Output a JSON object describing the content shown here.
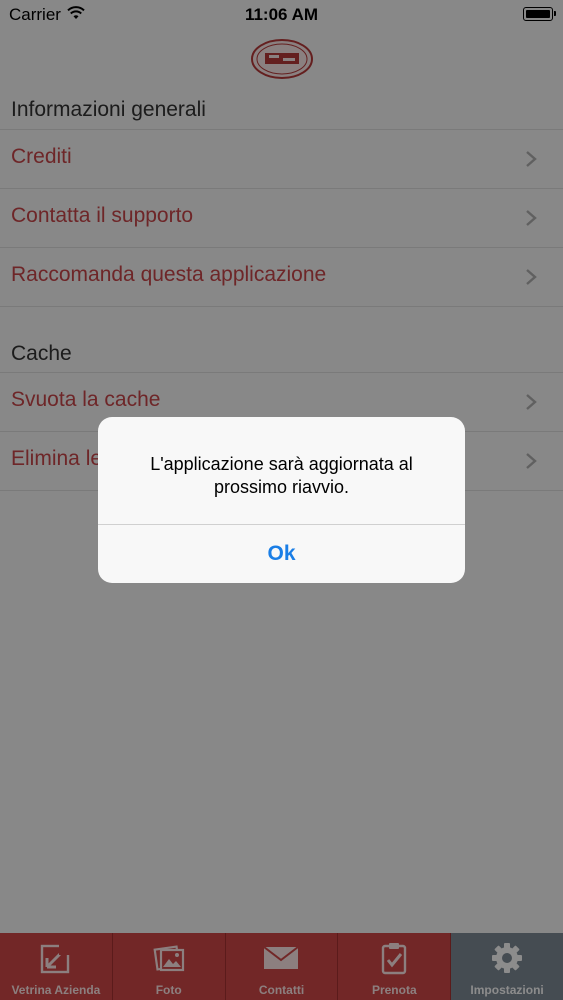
{
  "status_bar": {
    "carrier": "Carrier",
    "time": "11:06 AM"
  },
  "app": {
    "logo_icon": "company-logo-icon"
  },
  "sections": [
    {
      "header": "Informazioni generali",
      "items": [
        {
          "label": "Crediti"
        },
        {
          "label": "Contatta il supporto"
        },
        {
          "label": "Raccomanda questa applicazione"
        }
      ]
    },
    {
      "header": "Cache",
      "items": [
        {
          "label": "Svuota la cache"
        },
        {
          "label": "Elimina le"
        }
      ]
    }
  ],
  "alert": {
    "message": "L'applicazione sarà aggiornata al prossimo riavvio.",
    "ok_label": "Ok"
  },
  "tab_bar": {
    "tabs": [
      {
        "label": "Vetrina Azienda",
        "icon": "storefront-icon"
      },
      {
        "label": "Foto",
        "icon": "photos-icon"
      },
      {
        "label": "Contatti",
        "icon": "envelope-icon"
      },
      {
        "label": "Prenota",
        "icon": "clipboard-icon"
      },
      {
        "label": "Impostazioni",
        "icon": "gear-icon"
      }
    ],
    "active": "Impostazioni"
  },
  "colors": {
    "accent": "#c8464a",
    "tab_background": "#cf4848",
    "tab_active": "#7e8a96",
    "alert_button": "#1a7ee6"
  }
}
